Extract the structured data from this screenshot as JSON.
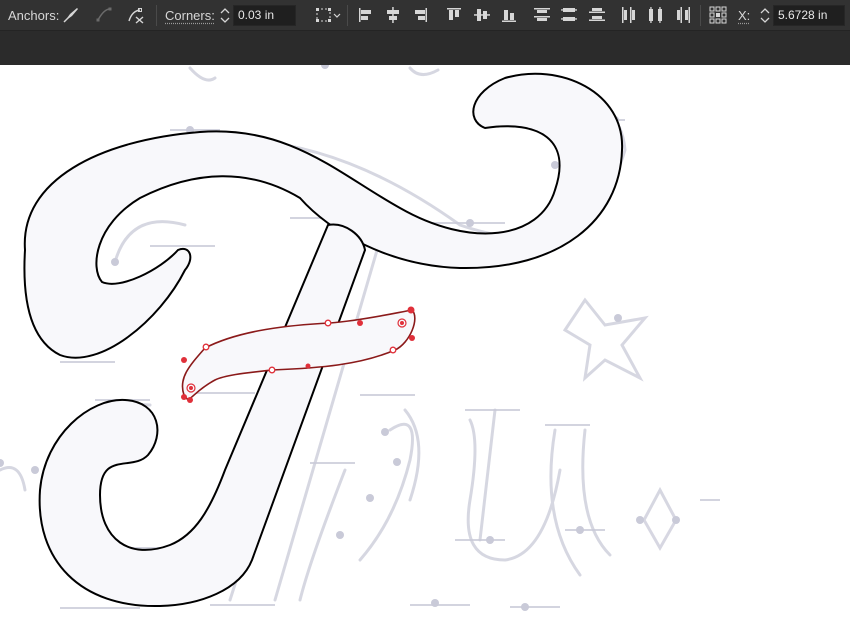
{
  "control_bar": {
    "anchors_label": "Anchors:",
    "anchor_tools": [
      "convert-anchor-to-corner-icon",
      "convert-anchor-to-smooth-icon",
      "remove-anchor-icon"
    ],
    "corners_label": "Corners:",
    "corners_value": "0.03 in",
    "align_tools": [
      "horizontal-align-left-icon",
      "horizontal-align-center-icon",
      "horizontal-align-right-icon",
      "vertical-align-top-icon",
      "vertical-align-center-icon",
      "vertical-align-bottom-icon",
      "vertical-distribute-top-icon",
      "vertical-distribute-center-icon",
      "vertical-distribute-bottom-icon",
      "horizontal-distribute-left-icon",
      "horizontal-distribute-center-icon",
      "horizontal-distribute-right-icon"
    ],
    "x_label": "X:",
    "x_value": "5.6728 in"
  },
  "colors": {
    "toolbar_bg": "#323232",
    "subbar_bg": "#2b2b2b",
    "path_stroke": "#000000",
    "selection_stroke": "#8b1a1a",
    "anchor_red": "#e0303a",
    "sketch_gray": "#c9cad8"
  }
}
